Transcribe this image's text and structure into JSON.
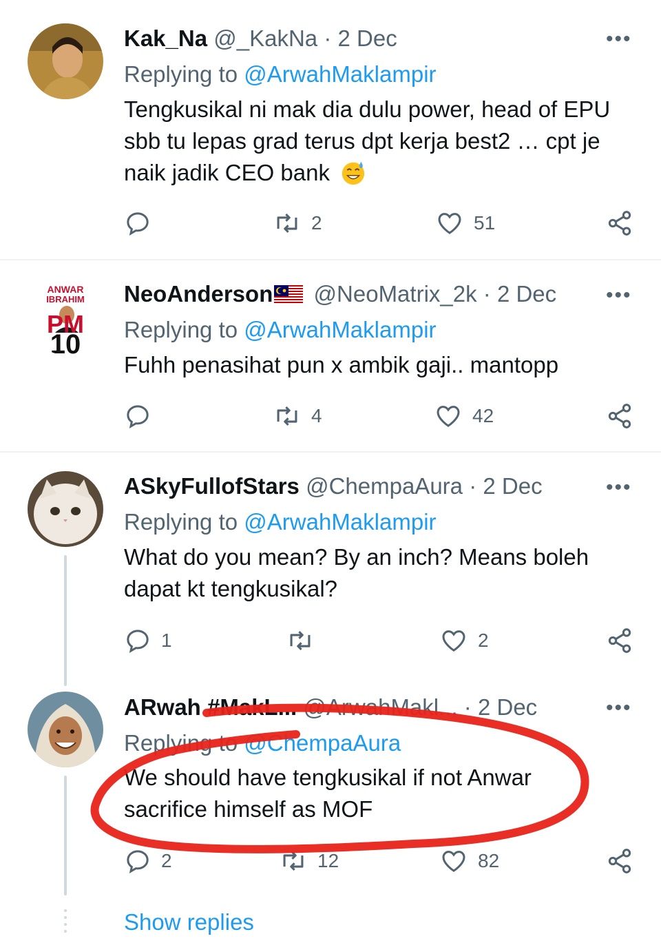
{
  "tweets": [
    {
      "name": "Kak_Na",
      "handle": "@_KakNa",
      "dot": "·",
      "date": "2 Dec",
      "replying_prefix": "Replying to",
      "replying_to": "@ArwahMaklampir",
      "text": "Tengkusikal ni mak dia dulu power, head of EPU sbb tu lepas grad terus dpt kerja best2 … cpt je naik jadik CEO bank",
      "emoji": "grinning-sweat-emoji",
      "retweets": "2",
      "likes": "51"
    },
    {
      "name": "NeoAnderson",
      "flag": "malaysia-flag-emoji",
      "handle": "@NeoMatrix_2k",
      "dot": "·",
      "date": "2 Dec",
      "replying_prefix": "Replying to",
      "replying_to": "@ArwahMaklampir",
      "text": "Fuhh penasihat pun x ambik gaji.. mantopp",
      "retweets": "4",
      "likes": "42",
      "avatar_text": [
        "ANWAR",
        "IBRAHIM",
        "PM",
        "10"
      ]
    },
    {
      "name": "ASkyFullofStars",
      "handle": "@ChempaAura",
      "dot": "·",
      "date": "2 Dec",
      "replying_prefix": "Replying to",
      "replying_to": "@ArwahMaklampir",
      "text": "What do you mean? By an inch? Means boleh dapat kt tengkusikal?",
      "replies": "1",
      "likes": "2"
    },
    {
      "name": "ARwah #MakL...",
      "handle": "@ArwahMakl...",
      "dot": "·",
      "date": "2 Dec",
      "replying_prefix": "Replying to",
      "replying_to": "@ChempaAura",
      "text": "We should have tengkusikal if not Anwar sacrifice himself as MOF",
      "replies": "2",
      "retweets": "12",
      "likes": "82"
    }
  ],
  "more_label": "•••",
  "show_replies": "Show replies",
  "colors": {
    "link": "#1d9bf0",
    "muted": "#536471",
    "annotation": "#e8231a"
  }
}
